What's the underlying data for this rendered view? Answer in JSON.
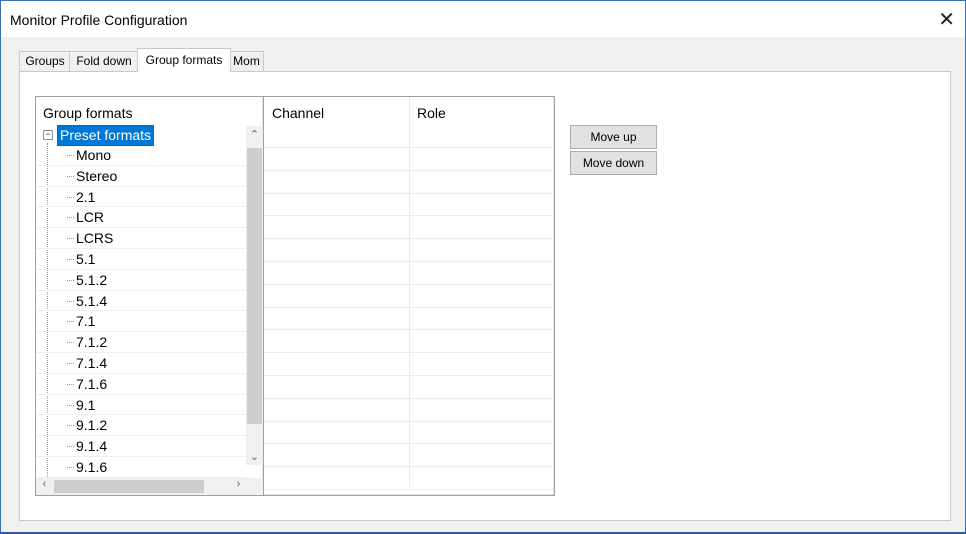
{
  "window": {
    "title": "Monitor Profile Configuration",
    "close_glyph": "✕"
  },
  "tabs": [
    {
      "label": "Groups",
      "active": false
    },
    {
      "label": "Fold down",
      "active": false
    },
    {
      "label": "Group formats",
      "active": true
    },
    {
      "label": "Mom",
      "active": false
    }
  ],
  "tree": {
    "header": "Group formats",
    "root": {
      "label": "Preset formats",
      "expanded": true,
      "expander_glyph": "−"
    },
    "items": [
      "Mono",
      "Stereo",
      "2.1",
      "LCR",
      "LCRS",
      "5.1",
      "5.1.2",
      "5.1.4",
      "7.1",
      "7.1.2",
      "7.1.4",
      "7.1.6",
      "9.1",
      "9.1.2",
      "9.1.4",
      "9.1.6"
    ],
    "scroll_icons": {
      "up": "up-arrow-icon",
      "down": "down-arrow-icon",
      "left": "left-arrow-icon",
      "right": "right-arrow-icon"
    }
  },
  "channel_table": {
    "columns": [
      "Channel",
      "Role"
    ],
    "rows": []
  },
  "buttons": {
    "move_up": "Move up",
    "move_down": "Move down"
  },
  "colors": {
    "selection": "#0078d7",
    "window_border": "#3a6fb8"
  }
}
